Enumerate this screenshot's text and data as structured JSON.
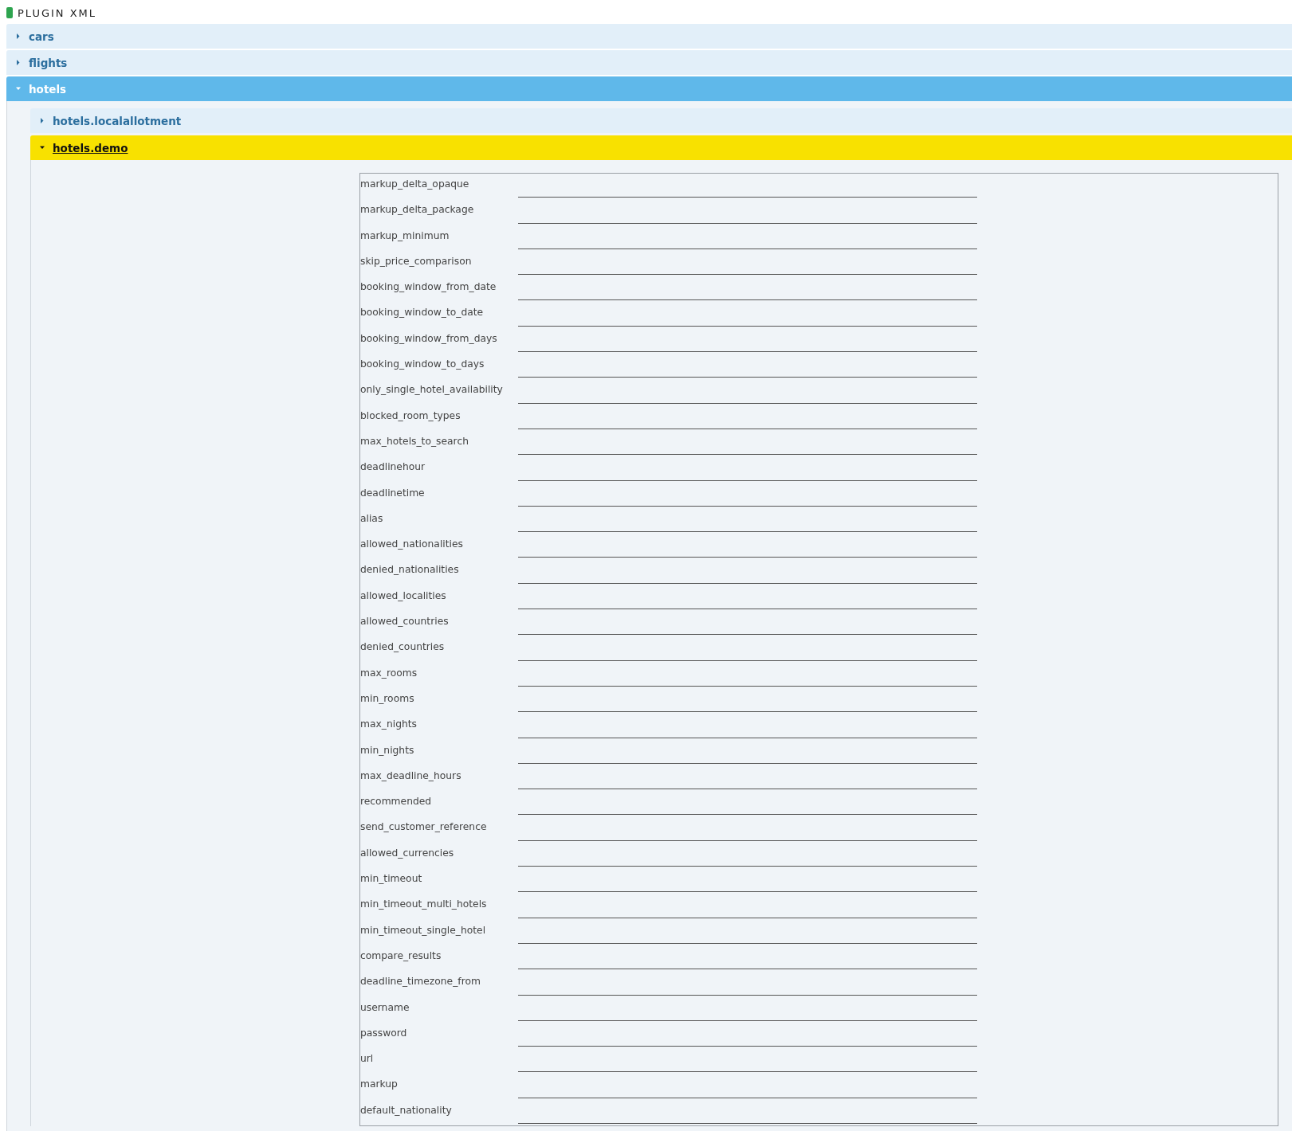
{
  "title": "PLUGIN XML",
  "sections": [
    {
      "label": "cars",
      "expanded": false,
      "selected": false
    },
    {
      "label": "flights",
      "expanded": false,
      "selected": false
    },
    {
      "label": "hotels",
      "expanded": true,
      "selected": false,
      "children": [
        {
          "label": "hotels.localallotment",
          "expanded": false,
          "selected": false
        },
        {
          "label": "hotels.demo",
          "expanded": true,
          "selected": true,
          "fields": [
            {
              "label": "markup_delta_opaque"
            },
            {
              "label": "markup_delta_package"
            },
            {
              "label": "markup_minimum"
            },
            {
              "label": "skip_price_comparison"
            },
            {
              "label": "booking_window_from_date"
            },
            {
              "label": "booking_window_to_date"
            },
            {
              "label": "booking_window_from_days"
            },
            {
              "label": "booking_window_to_days"
            },
            {
              "label": "only_single_hotel_availability"
            },
            {
              "label": "blocked_room_types"
            },
            {
              "label": "max_hotels_to_search"
            },
            {
              "label": "deadlinehour"
            },
            {
              "label": "deadlinetime"
            },
            {
              "label": "alias"
            },
            {
              "label": "allowed_nationalities"
            },
            {
              "label": "denied_nationalities"
            },
            {
              "label": "allowed_localities"
            },
            {
              "label": "allowed_countries"
            },
            {
              "label": "denied_countries"
            },
            {
              "label": "max_rooms"
            },
            {
              "label": "min_rooms"
            },
            {
              "label": "max_nights"
            },
            {
              "label": "min_nights"
            },
            {
              "label": "max_deadline_hours"
            },
            {
              "label": "recommended"
            },
            {
              "label": "send_customer_reference"
            },
            {
              "label": "allowed_currencies"
            },
            {
              "label": "min_timeout"
            },
            {
              "label": "min_timeout_multi_hotels"
            },
            {
              "label": "min_timeout_single_hotel"
            },
            {
              "label": "compare_results"
            },
            {
              "label": "deadline_timezone_from"
            },
            {
              "label": "username"
            },
            {
              "label": "password"
            },
            {
              "label": "url"
            },
            {
              "label": "markup"
            },
            {
              "label": "default_nationality"
            }
          ]
        }
      ]
    }
  ]
}
